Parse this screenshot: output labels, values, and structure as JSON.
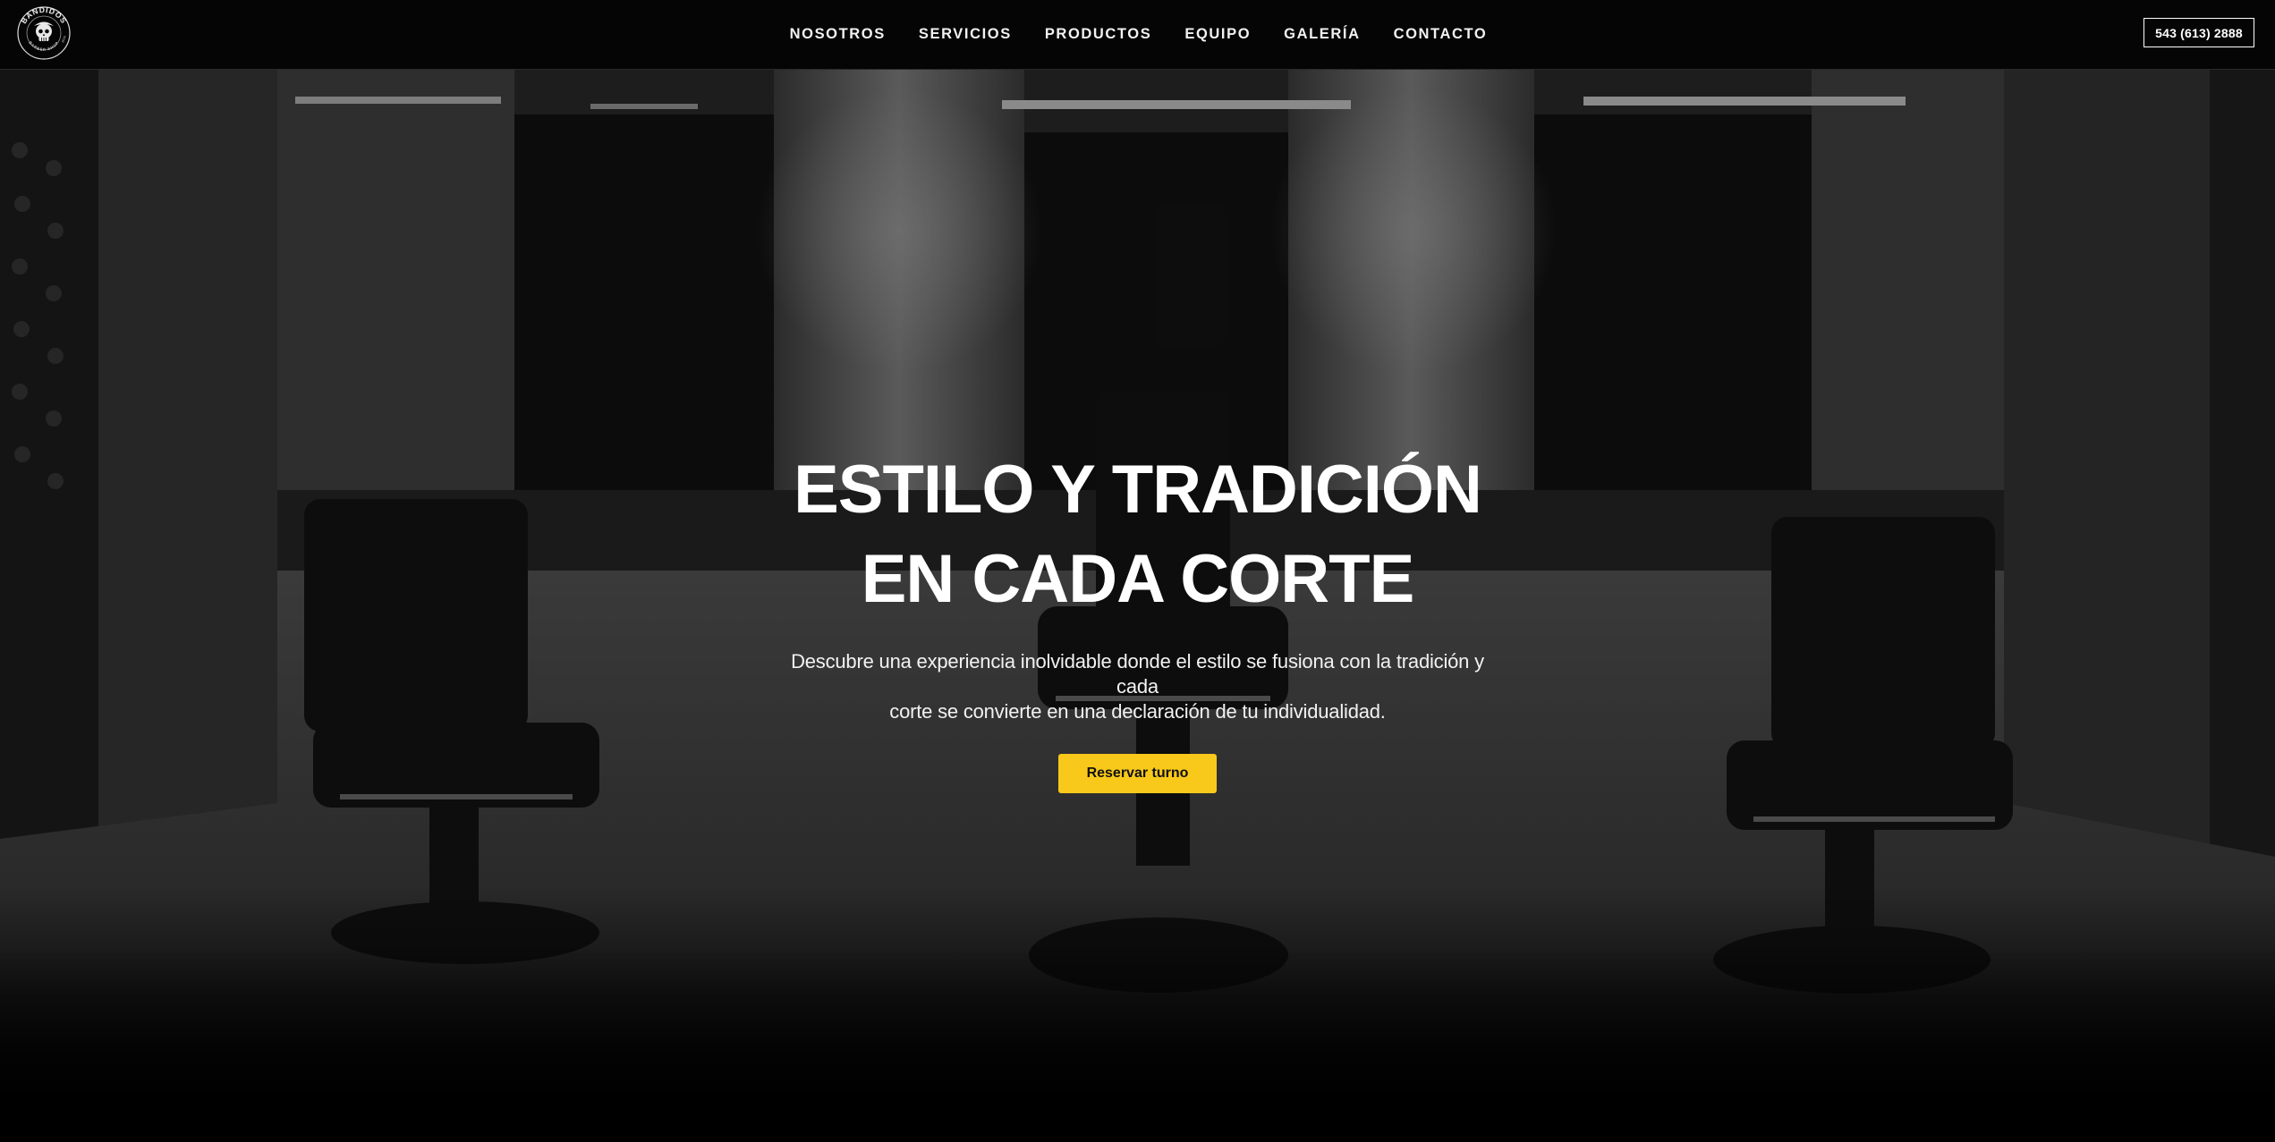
{
  "brand": {
    "logo_text_top": "BANDIDOS",
    "logo_text_bottom": "BARBER SHOP",
    "logo_year": "2016"
  },
  "nav": {
    "links": [
      {
        "label": "NOSOTROS"
      },
      {
        "label": "SERVICIOS"
      },
      {
        "label": "PRODUCTOS"
      },
      {
        "label": "EQUIPO"
      },
      {
        "label": "GALERÍA"
      },
      {
        "label": "CONTACTO"
      }
    ],
    "phone_label": "543 (613) 2888"
  },
  "hero": {
    "title_line1": "ESTILO Y TRADICIÓN",
    "title_line2": "EN CADA CORTE",
    "description_line1": "Descubre una experiencia inolvidable donde el estilo se fusiona con la tradición y cada",
    "description_line2": "corte se convierte en una declaración de tu individualidad.",
    "cta_label": "Reservar turno"
  },
  "colors": {
    "accent": "#f8c91a",
    "navbar_bg": "#050505",
    "text": "#ffffff"
  }
}
